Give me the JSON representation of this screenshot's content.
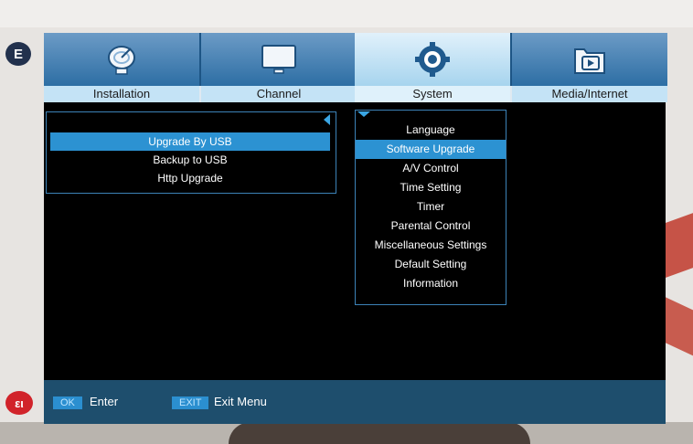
{
  "tabs": [
    {
      "label": "Installation",
      "icon": "satellite-dish-icon",
      "active": false
    },
    {
      "label": "Channel",
      "icon": "tv-monitor-icon",
      "active": false
    },
    {
      "label": "System",
      "icon": "gear-icon",
      "active": true
    },
    {
      "label": "Media/Internet",
      "icon": "media-folder-icon",
      "active": false
    }
  ],
  "left_menu": {
    "items": [
      "Upgrade By USB",
      "Backup to USB",
      "Http Upgrade"
    ],
    "selected": 0
  },
  "right_menu": {
    "items": [
      "Language",
      "Software Upgrade",
      "A/V Control",
      "Time Setting",
      "Timer",
      "Parental Control",
      "Miscellaneous Settings",
      "Default Setting",
      "Information"
    ],
    "selected": 1
  },
  "footer": {
    "ok_key": "OK",
    "ok_label": "Enter",
    "exit_key": "EXIT",
    "exit_label": "Exit Menu"
  },
  "colors": {
    "selection": "#2c92d2",
    "accent": "#3aa6e4",
    "footer_bg": "#1e4e6d"
  }
}
